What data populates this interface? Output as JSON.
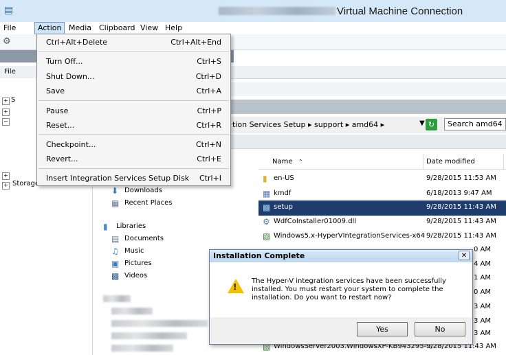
{
  "window": {
    "title": "Virtual Machine Connection"
  },
  "menubar": [
    "File",
    "Action",
    "Media",
    "Clipboard",
    "View",
    "Help"
  ],
  "action_menu": [
    {
      "label": "Ctrl+Alt+Delete",
      "shortcut": "Ctrl+Alt+End"
    },
    {
      "label": "Turn Off...",
      "shortcut": "Ctrl+S"
    },
    {
      "label": "Shut Down...",
      "shortcut": "Ctrl+D"
    },
    {
      "label": "Save",
      "shortcut": "Ctrl+A"
    },
    {
      "label": "Pause",
      "shortcut": "Ctrl+P"
    },
    {
      "label": "Reset...",
      "shortcut": "Ctrl+R"
    },
    {
      "label": "Checkpoint...",
      "shortcut": "Ctrl+N"
    },
    {
      "label": "Revert...",
      "shortcut": "Ctrl+E"
    },
    {
      "label": "Insert Integration Services Setup Disk",
      "shortcut": "Ctrl+I"
    }
  ],
  "explorer": {
    "address_crumb": "tion Services Setup ▸ support ▸ amd64 ▸",
    "search_placeholder": "Search amd64",
    "columns": {
      "name": "Name",
      "date": "Date modified"
    },
    "files": [
      {
        "name": "en-US",
        "date": "9/28/2015 11:53 AM",
        "icon": "folder"
      },
      {
        "name": "kmdf",
        "date": "6/18/2013 9:47 AM",
        "icon": "folder-doc"
      },
      {
        "name": "setup",
        "date": "9/28/2015 11:43 AM",
        "icon": "setup",
        "selected": true
      },
      {
        "name": "WdfCoInstaller01009.dll",
        "date": "9/28/2015 11:43 AM",
        "icon": "dll"
      },
      {
        "name": "Windows5.x-HyperVIntegrationServices-x64",
        "date": "9/28/2015 11:43 AM",
        "icon": "installer"
      },
      {
        "name": "WindowsServer2003.WindowsXP-KB943295-...",
        "date": "9/28/2015 11:43 AM",
        "icon": "installer"
      }
    ],
    "partial_dates": [
      "0 AM",
      "4 AM",
      "1 AM",
      "0 AM",
      "3 AM",
      "3 AM",
      "3 AM"
    ],
    "nav_items": [
      {
        "label": "Downloads",
        "icon": "downloads"
      },
      {
        "label": "Recent Places",
        "icon": "recent"
      },
      {
        "label": "Libraries",
        "icon": "libraries"
      },
      {
        "label": "Documents",
        "icon": "documents"
      },
      {
        "label": "Music",
        "icon": "music"
      },
      {
        "label": "Pictures",
        "icon": "pictures"
      },
      {
        "label": "Videos",
        "icon": "videos"
      }
    ],
    "inner_menu_label": "File",
    "tree_labels": [
      "S",
      "Storage"
    ]
  },
  "dialog": {
    "title": "Installation Complete",
    "close": "✕",
    "message": "The Hyper-V integration services have been successfully installed. You must restart your system to complete the installation. Do you want to restart now?",
    "yes": "Yes",
    "no": "No"
  }
}
